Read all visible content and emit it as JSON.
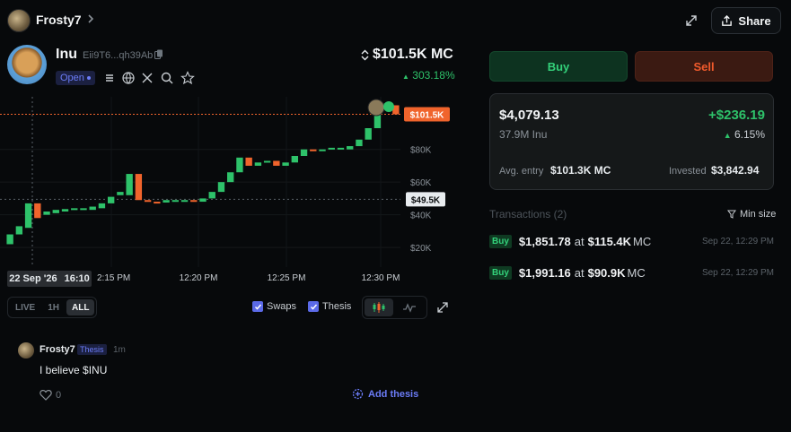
{
  "header": {
    "username": "Frosty7",
    "share_label": "Share"
  },
  "token": {
    "name": "Inu",
    "address": "Eii9T6...qh39Ab",
    "status": "Open",
    "market_cap": "$101.5K MC",
    "change": "303.18%"
  },
  "chart": {
    "y_ticks": [
      "$80K",
      "$60K",
      "$40K",
      "$20K"
    ],
    "current_label": "$101.5K",
    "crosshair_label": "$49.5K",
    "x_ticks": [
      "12:15 PM",
      "12:20 PM",
      "12:25 PM",
      "12:30 PM"
    ],
    "crosshair_date": "22 Sep '26",
    "crosshair_time": "16:10",
    "x_tick_partial": "2:15 PM"
  },
  "chart_data": {
    "type": "candlestick",
    "y_ticks": [
      "$80K",
      "$60K",
      "$40K",
      "$20K"
    ],
    "x_ticks": [
      "12:15 PM",
      "12:20 PM",
      "12:25 PM",
      "12:30 PM"
    ],
    "current_price_label": "$101.5K",
    "crosshair_label": "$49.5K",
    "ylim": [
      8000,
      110000
    ],
    "candles": [
      {
        "o": 22000,
        "c": 28000
      },
      {
        "o": 28000,
        "c": 33000
      },
      {
        "o": 32000,
        "c": 47000
      },
      {
        "o": 47000,
        "c": 38000
      },
      {
        "o": 40000,
        "c": 42000
      },
      {
        "o": 41000,
        "c": 43000
      },
      {
        "o": 42000,
        "c": 43500
      },
      {
        "o": 43000,
        "c": 44000
      },
      {
        "o": 43500,
        "c": 44000
      },
      {
        "o": 43000,
        "c": 45000
      },
      {
        "o": 44000,
        "c": 47000
      },
      {
        "o": 47000,
        "c": 51000
      },
      {
        "o": 52000,
        "c": 54000
      },
      {
        "o": 52000,
        "c": 65000
      },
      {
        "o": 65000,
        "c": 49000
      },
      {
        "o": 49000,
        "c": 48000
      },
      {
        "o": 48000,
        "c": 47500
      },
      {
        "o": 47500,
        "c": 49000
      },
      {
        "o": 48000,
        "c": 49000
      },
      {
        "o": 48500,
        "c": 49000
      },
      {
        "o": 49000,
        "c": 48500
      },
      {
        "o": 48000,
        "c": 50000
      },
      {
        "o": 50000,
        "c": 54000
      },
      {
        "o": 54000,
        "c": 60000
      },
      {
        "o": 60000,
        "c": 66000
      },
      {
        "o": 66000,
        "c": 75000
      },
      {
        "o": 75000,
        "c": 70000
      },
      {
        "o": 70000,
        "c": 72000
      },
      {
        "o": 72000,
        "c": 73000
      },
      {
        "o": 73000,
        "c": 70000
      },
      {
        "o": 70000,
        "c": 72000
      },
      {
        "o": 72000,
        "c": 76000
      },
      {
        "o": 76000,
        "c": 80000
      },
      {
        "o": 80000,
        "c": 79000
      },
      {
        "o": 79000,
        "c": 80000
      },
      {
        "o": 80000,
        "c": 81000
      },
      {
        "o": 80000,
        "c": 81000
      },
      {
        "o": 80000,
        "c": 82000
      },
      {
        "o": 82000,
        "c": 86000
      },
      {
        "o": 86000,
        "c": 93000
      },
      {
        "o": 93000,
        "c": 105000
      },
      {
        "o": 105000,
        "c": 108000
      },
      {
        "o": 107000,
        "c": 101500
      }
    ]
  },
  "controls": {
    "ranges": [
      "LIVE",
      "1H",
      "ALL"
    ],
    "active_range": "ALL",
    "swaps_label": "Swaps",
    "thesis_label": "Thesis"
  },
  "thesis": {
    "user": "Frosty7",
    "tag": "Thesis",
    "time": "1m",
    "text": "I believe $INU",
    "likes": "0",
    "add_label": "Add thesis"
  },
  "trade": {
    "buy_label": "Buy",
    "sell_label": "Sell"
  },
  "position": {
    "value": "$4,079.13",
    "pnl": "+$236.19",
    "amount": "37.9M Inu",
    "pnl_pct": "6.15%",
    "avg_label": "Avg. entry",
    "avg_value": "$101.3K MC",
    "invested_label": "Invested",
    "invested_value": "$3,842.94"
  },
  "transactions": {
    "title": "Transactions (2)",
    "min_size_label": "Min size",
    "items": [
      {
        "type": "Buy",
        "amount": "$1,851.78",
        "at": "at",
        "mc": "$115.4K",
        "mc_unit": "MC",
        "date": "Sep 22, 12:29 PM"
      },
      {
        "type": "Buy",
        "amount": "$1,991.16",
        "at": "at",
        "mc": "$90.9K",
        "mc_unit": "MC",
        "date": "Sep 22, 12:29 PM"
      }
    ]
  },
  "colors": {
    "up": "#2ec26a",
    "down": "#f0642c",
    "accent": "#6b7cf7"
  }
}
